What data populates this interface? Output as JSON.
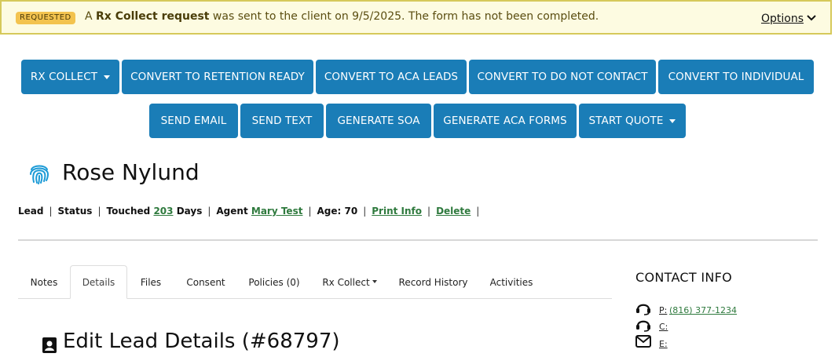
{
  "banner": {
    "badge": "REQUESTED",
    "msg_prefix": "A ",
    "msg_bold": "Rx Collect request",
    "msg_suffix": " was sent to the client on 9/5/2025. The form has not been completed.",
    "options_label": "Options"
  },
  "actions": {
    "row1": [
      "RX COLLECT",
      "CONVERT TO RETENTION READY",
      "CONVERT TO ACA LEADS",
      "CONVERT TO DO NOT CONTACT",
      "CONVERT TO INDIVIDUAL"
    ],
    "row2": [
      "SEND EMAIL",
      "SEND TEXT",
      "GENERATE SOA",
      "GENERATE ACA FORMS",
      "START QUOTE"
    ]
  },
  "lead": {
    "name": "Rose Nylund",
    "type": "Lead",
    "status_label": "Status",
    "touched_label": "Touched",
    "touched_days": "203",
    "days_label": "Days",
    "agent_label": "Agent",
    "agent_name": "Mary Test",
    "age_text": "Age: 70",
    "print_info": "Print Info",
    "delete": "Delete"
  },
  "tabs": [
    "Notes",
    "Details",
    "Files",
    "Consent",
    "Policies (0)",
    "Rx Collect",
    "Record History",
    "Activities"
  ],
  "edit_heading": "Edit Lead Details (#68797)",
  "contact": {
    "title": "CONTACT INFO",
    "phone_label": "P:",
    "phone_value": "(816) 377-1234",
    "cell_label": "C:",
    "email_label": "E:"
  },
  "colors": {
    "button": "#1a7db7",
    "banner_bg": "#fdfbe1",
    "badge": "#f3c34f",
    "link": "#2f7a3e"
  }
}
